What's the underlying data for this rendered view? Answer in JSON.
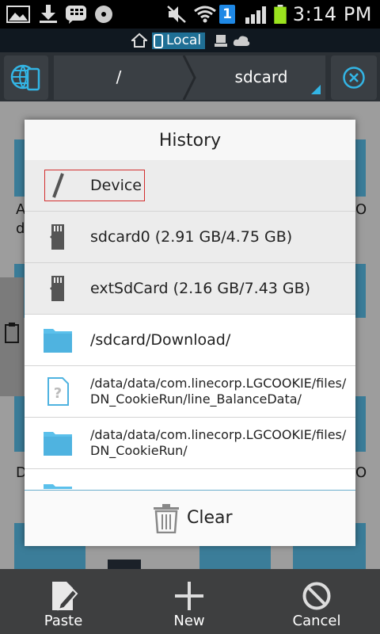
{
  "status_bar": {
    "time": "3:14 PM",
    "notification_count": "1",
    "icons": [
      "gallery-icon",
      "download-icon",
      "bbm-icon",
      "music-disc-icon",
      "mute-icon",
      "wifi-icon",
      "signal-icon",
      "battery-icon"
    ]
  },
  "location_bar": {
    "local_label": "Local",
    "icons": [
      "home-icon",
      "phone-icon",
      "computer-icon",
      "cloud-icon"
    ]
  },
  "toolbar": {
    "crumbs": [
      "/",
      "sdcard"
    ]
  },
  "background": {
    "partial_labels": [
      "A",
      "d",
      "O",
      "D",
      "O"
    ]
  },
  "dialog": {
    "title": "History",
    "items": [
      {
        "label": "Device",
        "icon": "root-slash-icon"
      },
      {
        "label": "sdcard0 (2.91 GB/4.75 GB)",
        "icon": "sdcard-icon"
      },
      {
        "label": "extSdCard (2.16 GB/7.43 GB)",
        "icon": "sdcard-icon"
      },
      {
        "label": "/sdcard/Download/",
        "icon": "folder-icon"
      },
      {
        "label": "/data/data/com.linecorp.LGCOOKIE/files/\nDN_CookieRun/line_BalanceData/",
        "icon": "unknown-file-icon"
      },
      {
        "label": "/data/data/com.linecorp.LGCOOKIE/files/\nDN_CookieRun/",
        "icon": "folder-icon"
      }
    ],
    "clear_label": "Clear"
  },
  "bottom_bar": {
    "paste": "Paste",
    "new": "New",
    "cancel": "Cancel"
  },
  "colors": {
    "accent_blue": "#33b5e5",
    "folder_blue": "#5bc0eb",
    "highlight_red": "#d32f2f",
    "battery_green": "#9be31e"
  }
}
